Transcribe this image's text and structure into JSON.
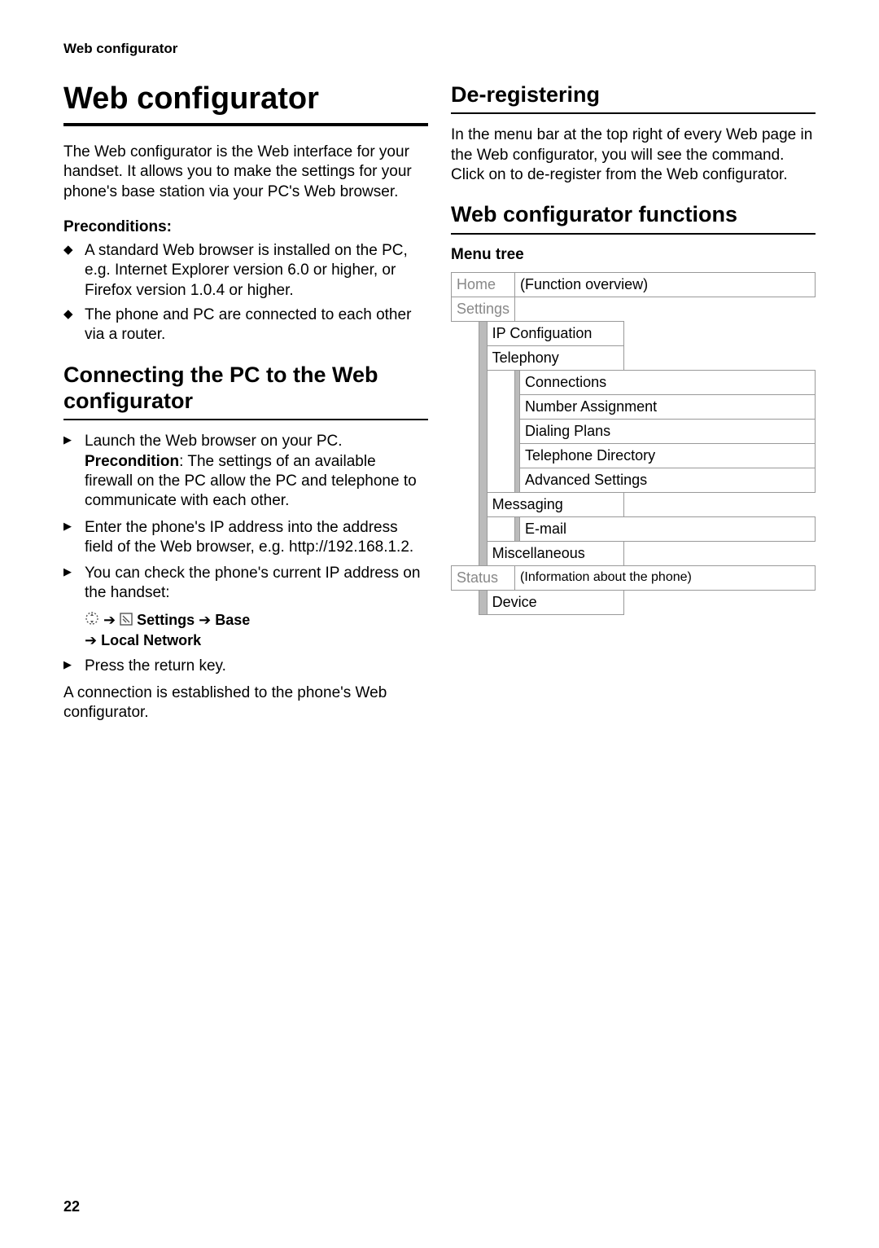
{
  "running_head": "Web configurator",
  "page_number": "22",
  "left": {
    "h1": "Web configurator",
    "intro": "The Web configurator is the Web interface for your handset. It allows you to make the settings for your phone's base station via your PC's Web browser.",
    "preconditions_label": "Preconditions:",
    "preconditions": [
      "A standard Web browser is installed on the PC, e.g. Internet Explorer version 6.0 or higher, or Firefox version 1.0.4 or higher.",
      "The phone and PC are connected to each other via a router."
    ],
    "connect_title": "Connecting the PC to the Web configurator",
    "steps": [
      {
        "pre": "Launch the Web browser on your PC. ",
        "bold": "Precondition",
        "post": ": The settings of an available firewall on the PC allow the PC and telephone to communicate with each other."
      },
      {
        "pre": "Enter the phone's IP address into the address field of the Web browser, e.g. http://192.168.1.2.",
        "bold": "",
        "post": ""
      },
      {
        "pre": "You can check the phone's current IP address on the handset:",
        "bold": "",
        "post": ""
      }
    ],
    "menu_settings": "Settings",
    "menu_base": "Base",
    "menu_local_network": "Local Network",
    "step_press": "Press the return key.",
    "outro": "A connection is established to the phone's Web configurator."
  },
  "right": {
    "dereg_title": "De-registering",
    "dereg_body": "In the menu bar at the top right of every Web page in the Web configurator, you will see the command. Click on  to de-register from the Web configurator.",
    "func_title": "Web configurator functions",
    "menutree_label": "Menu tree",
    "tree": {
      "home": "Home",
      "home_note": "(Function overview)",
      "settings": "Settings",
      "ip": "IP Configuation",
      "telephony": "Telephony",
      "connections": "Connections",
      "number_assignment": "Number Assignment",
      "dialing_plans": "Dialing Plans",
      "telephone_directory": "Telephone Directory",
      "advanced_settings": "Advanced Settings",
      "messaging": "Messaging",
      "email": "E-mail",
      "misc": "Miscellaneous",
      "status": "Status",
      "status_note": "(Information about the phone)",
      "device": "Device"
    }
  }
}
